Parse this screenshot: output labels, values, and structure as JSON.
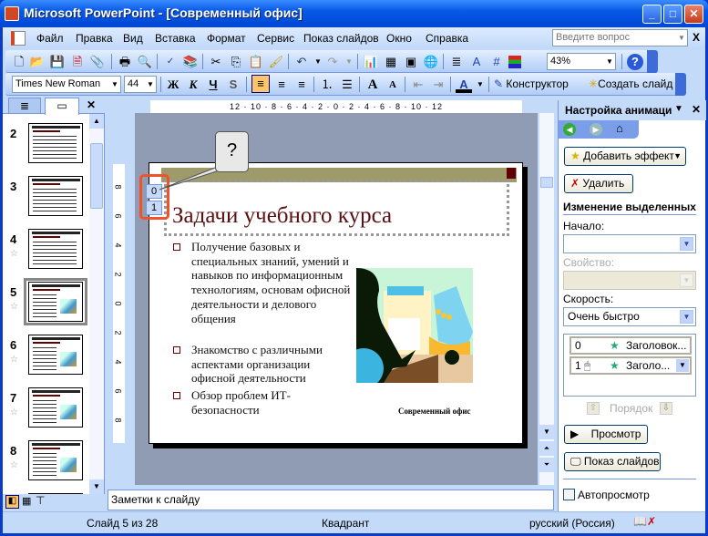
{
  "window": {
    "title": "Microsoft PowerPoint - [Современный офис]",
    "minimize": "_",
    "maximize": "□",
    "close": "✕"
  },
  "menu": {
    "items": [
      "Файл",
      "Правка",
      "Вид",
      "Вставка",
      "Формат",
      "Сервис",
      "Показ слайдов",
      "Окно",
      "Справка"
    ],
    "help_placeholder": "Введите вопрос",
    "close_doc": "X"
  },
  "toolbar_standard": {
    "zoom": "43%"
  },
  "toolbar_format": {
    "font": "Times New Roman",
    "size": "44",
    "bold": "Ж",
    "italic": "К",
    "underline": "Ч",
    "shadow": "S",
    "design": "Конструктор",
    "new_slide": "Создать слайд"
  },
  "slides_pane": {
    "thumbnails": [
      {
        "n": "2",
        "anim": false
      },
      {
        "n": "3",
        "anim": false
      },
      {
        "n": "4",
        "anim": true
      },
      {
        "n": "5",
        "anim": true,
        "selected": true
      },
      {
        "n": "6",
        "anim": true
      },
      {
        "n": "7",
        "anim": true
      },
      {
        "n": "8",
        "anim": true
      }
    ]
  },
  "rulers": {
    "horizontal": "12 · 10 · 8 · 6 · 4 · 2 · 0 · 2 · 4 · 6 · 8 · 10 · 12",
    "vertical": [
      "8",
      "6",
      "4",
      "2",
      "0",
      "2",
      "4",
      "6",
      "8"
    ]
  },
  "slide": {
    "title": "Задачи учебного курса",
    "tags": [
      "0",
      "1"
    ],
    "callout": "?",
    "bullets": [
      "Получение базовых и специальных знаний, умений и навыков по информационным технологиям, основам офисной деятельности и делового общения",
      "Знакомство с различными аспектами организации офисной деятельности",
      "Обзор проблем ИТ-безопасности"
    ],
    "caption": "Современный офис"
  },
  "notes": {
    "placeholder": "Заметки к слайду"
  },
  "task_pane": {
    "title": "Настройка анимации",
    "add_effect": "Добавить эффект",
    "remove": "Удалить",
    "section": "Изменение выделенных",
    "start_label": "Начало:",
    "start_value": "",
    "property_label": "Свойство:",
    "speed_label": "Скорость:",
    "speed_value": "Очень быстро",
    "effects": [
      {
        "order": "0",
        "name": "Заголовок..."
      },
      {
        "order": "1",
        "name": "Заголо..."
      }
    ],
    "reorder": "Порядок",
    "play": "Просмотр",
    "slideshow": "Показ слайдов",
    "autopreview": "Автопросмотр",
    "autopreview_checked": false
  },
  "status": {
    "slide": "Слайд 5 из 28",
    "design": "Квадрант",
    "language": "русский (Россия)"
  },
  "colors": {
    "titlebar": "#0859E6",
    "slide_title": "#5A1010",
    "slide_bar": "#9E9A6A",
    "accent_square": "#600000",
    "highlight": "#F0522A"
  }
}
